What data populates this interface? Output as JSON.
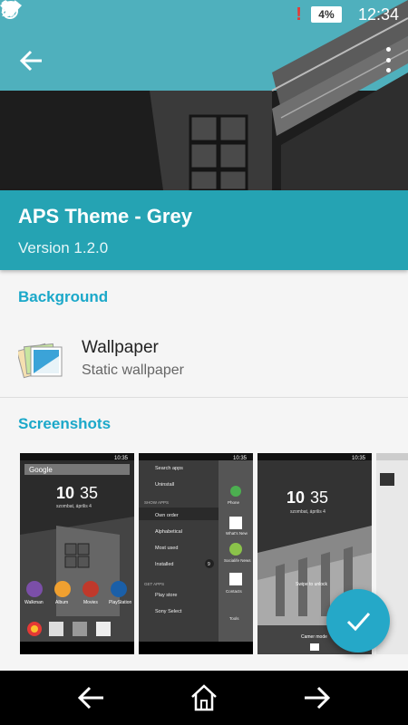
{
  "status_bar": {
    "time": "12:34",
    "battery": "4%",
    "alert": "!",
    "icons": [
      "bluetooth-icon",
      "alarm-icon",
      "wifi-icon",
      "signal-icon",
      "battery-icon"
    ]
  },
  "app_bar": {
    "back_icon": "arrow-left-icon",
    "overflow_icon": "more-vert-icon"
  },
  "theme": {
    "title": "APS Theme - Grey",
    "version": "Version 1.2.0"
  },
  "sections": {
    "background": "Background",
    "screenshots": "Screenshots"
  },
  "wallpaper": {
    "name": "Wallpaper",
    "description": "Static wallpaper",
    "icon": "wallpaper-icon"
  },
  "screenshots": {
    "shot1": {
      "search": "Google",
      "time_h": "10",
      "time_m": "35",
      "date": "szombat, április 4",
      "statusbar_time": "10:35",
      "apps": [
        "Walkman",
        "Album",
        "Movies",
        "PlayStation"
      ]
    },
    "shot2": {
      "statusbar_time": "10:35",
      "menu": [
        "Search apps",
        "Uninstall"
      ],
      "show_apps_header": "SHOW APPS",
      "show_apps": [
        "Own order",
        "Alphabetical",
        "Most used",
        "Installed"
      ],
      "installed_count": "9",
      "get_apps_header": "GET APPS",
      "get_apps": [
        "Play store",
        "Sony Select"
      ],
      "side_apps": [
        "Phone",
        "What's New",
        "Socialife News",
        "Contacts",
        "Tools"
      ]
    },
    "shot3": {
      "statusbar_time": "10:35",
      "time_h": "10",
      "time_m": "35",
      "date": "szombat, április 4",
      "hint": "Swipe to unlock",
      "camera": "Camer mode"
    }
  },
  "fab": {
    "icon": "check-icon"
  },
  "nav_bar": {
    "back": "arrow-left-icon",
    "home": "home-icon",
    "forward": "arrow-right-icon"
  },
  "colors": {
    "accent": "#25a3b3",
    "section_label": "#1ba8c9",
    "fab": "#25a8c8"
  }
}
